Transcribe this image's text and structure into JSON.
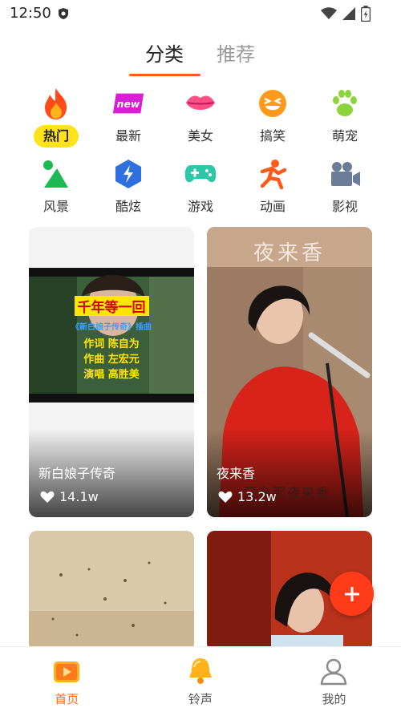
{
  "status_bar": {
    "time": "12:50"
  },
  "tabs": [
    {
      "label": "分类",
      "active": true
    },
    {
      "label": "推荐",
      "active": false
    }
  ],
  "categories": [
    {
      "label": "热门",
      "icon": "flame-icon",
      "active": true
    },
    {
      "label": "最新",
      "icon": "new-badge-icon",
      "active": false
    },
    {
      "label": "美女",
      "icon": "lips-icon",
      "active": false
    },
    {
      "label": "搞笑",
      "icon": "laughing-face-icon",
      "active": false
    },
    {
      "label": "萌宠",
      "icon": "paw-icon",
      "active": false
    },
    {
      "label": "风景",
      "icon": "mountain-icon",
      "active": false
    },
    {
      "label": "酷炫",
      "icon": "lightning-icon",
      "active": false
    },
    {
      "label": "游戏",
      "icon": "gamepad-icon",
      "active": false
    },
    {
      "label": "动画",
      "icon": "running-figure-icon",
      "active": false
    },
    {
      "label": "影视",
      "icon": "video-camera-icon",
      "active": false
    }
  ],
  "cards": [
    {
      "title": "新白娘子传奇",
      "likes": "14.1w",
      "thumbnail_text": [
        "千年等一回",
        "《新白娘子传奇》插曲",
        "作词  陈自为",
        "作曲  左宏元",
        "演唱  高胜美"
      ]
    },
    {
      "title": "夜来香",
      "likes": "13.2w",
      "thumbnail_text": [
        "夜来香",
        "只有那夜来香"
      ]
    }
  ],
  "bottom_nav": [
    {
      "label": "首页",
      "icon": "home-play-icon",
      "active": true
    },
    {
      "label": "铃声",
      "icon": "bell-icon",
      "active": false
    },
    {
      "label": "我的",
      "icon": "user-icon",
      "active": false
    }
  ],
  "colors": {
    "accent": "#ff5b1f",
    "active_tag": "#ffe21a",
    "fab": "#ff3b1a"
  }
}
